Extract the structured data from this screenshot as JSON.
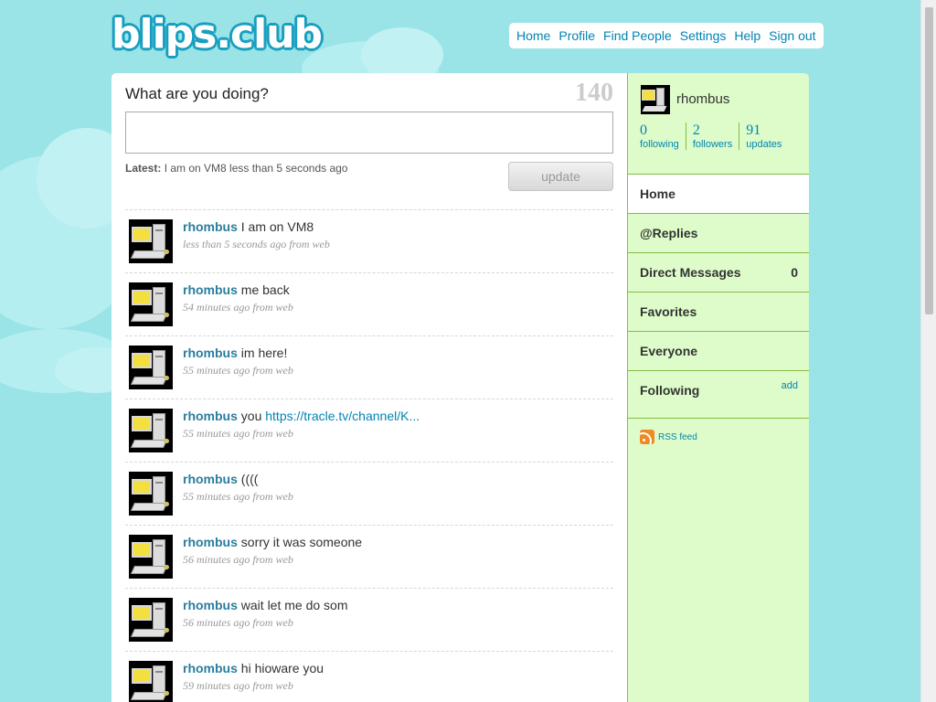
{
  "brand": {
    "logo_text": "blips.club"
  },
  "topnav": {
    "items": [
      {
        "label": "Home"
      },
      {
        "label": "Profile"
      },
      {
        "label": "Find People"
      },
      {
        "label": "Settings"
      },
      {
        "label": "Help"
      },
      {
        "label": "Sign out"
      }
    ]
  },
  "composer": {
    "prompt": "What are you doing?",
    "char_count": "140",
    "input_value": "",
    "latest_label": "Latest:",
    "latest_text": "I am on VM8 less than 5 seconds ago",
    "update_label": "update"
  },
  "timeline": [
    {
      "user": "rhombus",
      "text": "I am on VM8",
      "link": "",
      "meta": "less than 5 seconds ago from web"
    },
    {
      "user": "rhombus",
      "text": "me back",
      "link": "",
      "meta": "54 minutes ago from web"
    },
    {
      "user": "rhombus",
      "text": "im here!",
      "link": "",
      "meta": "55 minutes ago from web"
    },
    {
      "user": "rhombus",
      "text": "you",
      "link": "https://tracle.tv/channel/K...",
      "meta": "55 minutes ago from web"
    },
    {
      "user": "rhombus",
      "text": "((((",
      "link": "",
      "meta": "55 minutes ago from web"
    },
    {
      "user": "rhombus",
      "text": "sorry it was someone",
      "link": "",
      "meta": "56 minutes ago from web"
    },
    {
      "user": "rhombus",
      "text": "wait let me do som",
      "link": "",
      "meta": "56 minutes ago from web"
    },
    {
      "user": "rhombus",
      "text": "hi hioware you",
      "link": "",
      "meta": "59 minutes ago from web"
    }
  ],
  "sidebar": {
    "username": "rhombus",
    "stats": [
      {
        "num": "0",
        "label": "following"
      },
      {
        "num": "2",
        "label": "followers"
      },
      {
        "num": "91",
        "label": "updates"
      }
    ],
    "menu": {
      "home": "Home",
      "replies": "@Replies",
      "direct_messages": "Direct Messages",
      "dm_count": "0",
      "favorites": "Favorites",
      "everyone": "Everyone",
      "following": "Following",
      "following_add": "add"
    },
    "rss_label": "RSS feed"
  },
  "colors": {
    "background": "#9ae4e8",
    "link": "#0084b4",
    "sidebar": "#ddfcc9",
    "sidebar_border": "#87bc44"
  }
}
